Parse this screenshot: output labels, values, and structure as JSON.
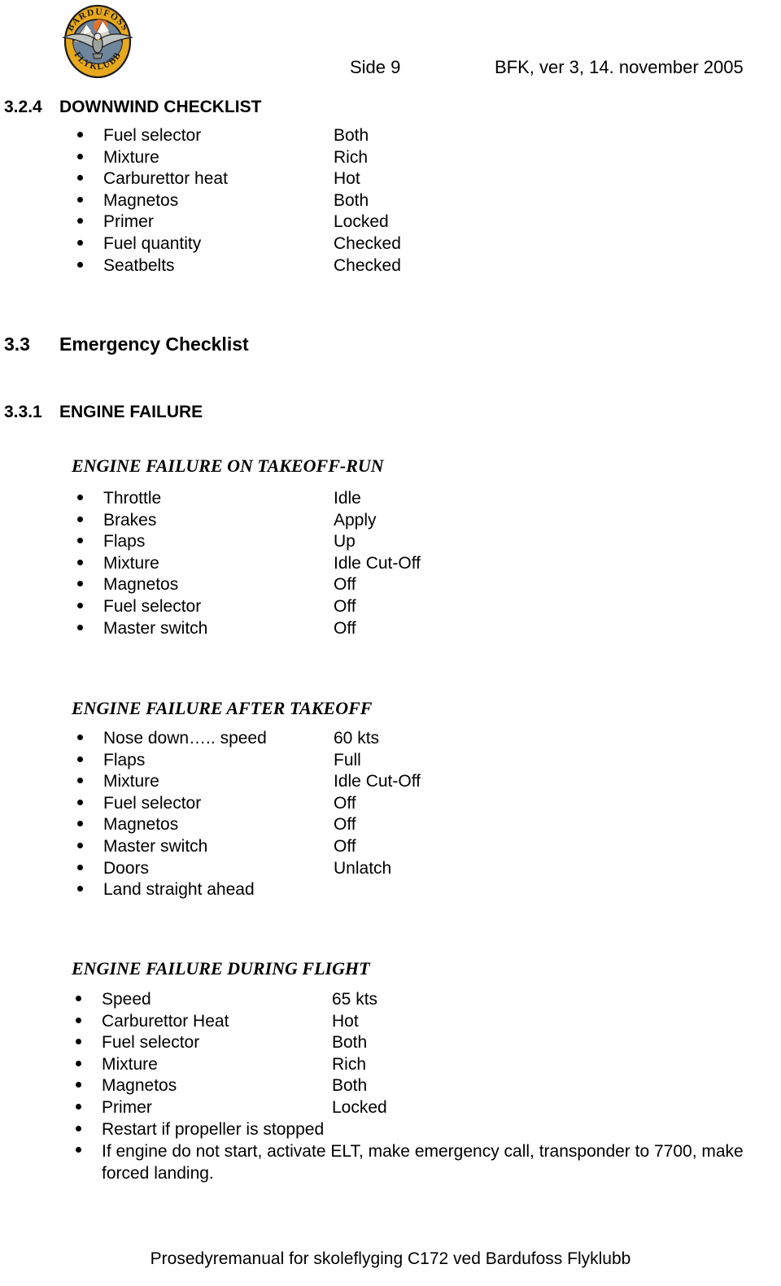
{
  "header": {
    "logo": {
      "icon": "bardufoss-flyklubb-crest-icon",
      "top_arc_text": "BARDUFOSS",
      "bottom_arc_text": "FLYKLUBB",
      "ring_color": "#E8A81C",
      "field_color": "#6E859B",
      "sun_color": "#E8712A",
      "outline_color": "#1B1B1B"
    },
    "page_label": "Side 9",
    "version_label": "BFK, ver 3,  14. november 2005"
  },
  "sections": [
    {
      "number": "3.2.4",
      "title": "DOWNWIND CHECKLIST",
      "items": [
        {
          "label": "Fuel selector",
          "value": "Both"
        },
        {
          "label": "Mixture",
          "value": "Rich"
        },
        {
          "label": "Carburettor heat",
          "value": "Hot"
        },
        {
          "label": "Magnetos",
          "value": "Both"
        },
        {
          "label": "Primer",
          "value": "Locked"
        },
        {
          "label": "Fuel quantity",
          "value": "Checked"
        },
        {
          "label": "Seatbelts",
          "value": "Checked"
        }
      ]
    },
    {
      "number": "3.3",
      "title": "Emergency Checklist"
    },
    {
      "number": "3.3.1",
      "title": "ENGINE FAILURE"
    }
  ],
  "subsections": [
    {
      "heading": "ENGINE FAILURE ON TAKEOFF-RUN",
      "items": [
        {
          "label": "Throttle",
          "value": "Idle"
        },
        {
          "label": "Brakes",
          "value": "Apply"
        },
        {
          "label": "Flaps",
          "value": "Up"
        },
        {
          "label": "Mixture",
          "value": "Idle Cut-Off"
        },
        {
          "label": "Magnetos",
          "value": "Off"
        },
        {
          "label": "Fuel selector",
          "value": "Off"
        },
        {
          "label": "Master switch",
          "value": "Off"
        }
      ]
    },
    {
      "heading": "ENGINE FAILURE AFTER TAKEOFF",
      "items": [
        {
          "label": "Nose down….. speed",
          "value": "60 kts"
        },
        {
          "label": "Flaps",
          "value": "Full"
        },
        {
          "label": "Mixture",
          "value": "Idle Cut-Off"
        },
        {
          "label": "Fuel selector",
          "value": "Off"
        },
        {
          "label": "Magnetos",
          "value": "Off"
        },
        {
          "label": "Master switch",
          "value": "Off"
        },
        {
          "label": "Doors",
          "value": "Unlatch"
        },
        {
          "label": "Land straight ahead",
          "value": ""
        }
      ]
    },
    {
      "heading": "ENGINE FAILURE DURING FLIGHT",
      "items": [
        {
          "label": "Speed",
          "value": "65 kts"
        },
        {
          "label": "Carburettor Heat",
          "value": "Hot"
        },
        {
          "label": "Fuel selector",
          "value": "Both"
        },
        {
          "label": "Mixture",
          "value": "Rich"
        },
        {
          "label": "Magnetos",
          "value": "Both"
        },
        {
          "label": "Primer",
          "value": "Locked"
        },
        {
          "label": "Restart if propeller is stopped",
          "value": ""
        },
        {
          "label": "If engine do not start, activate ELT,  make emergency call, transponder to 7700, make forced landing.",
          "value": ""
        }
      ]
    }
  ],
  "footer": {
    "text": "Prosedyremanual for skoleflyging C172 ved Bardufoss Flyklubb"
  }
}
